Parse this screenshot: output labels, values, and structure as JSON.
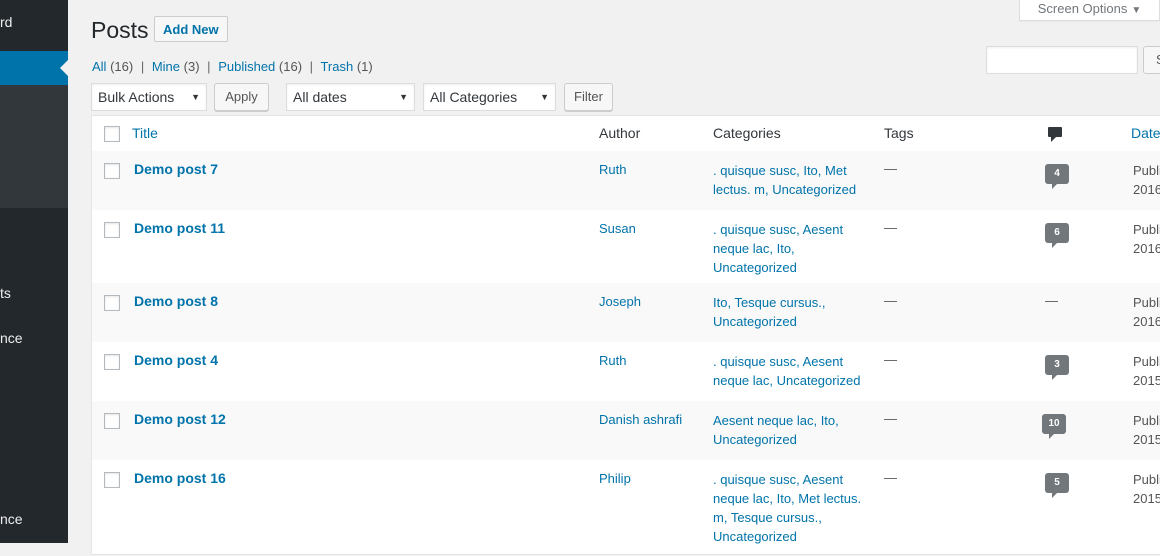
{
  "sidebar": {
    "items": [
      {
        "label": "Dashboard",
        "visible_text": "rd"
      },
      {
        "label": "Posts",
        "visible_text": "ts"
      },
      {
        "label": "Appearance",
        "visible_text": "nce"
      },
      {
        "label": "Appearance",
        "visible_text": "nce"
      }
    ],
    "accent_color": "#0073aa",
    "background_color": "#23282d"
  },
  "screen_options": {
    "label": "Screen Options"
  },
  "header": {
    "title": "Posts",
    "add_new_label": "Add New"
  },
  "filters": {
    "all": {
      "label": "All",
      "count": "(16)"
    },
    "mine": {
      "label": "Mine",
      "count": "(3)"
    },
    "published": {
      "label": "Published",
      "count": "(16)"
    },
    "trash": {
      "label": "Trash",
      "count": "(1)"
    },
    "separator": "|"
  },
  "search": {
    "placeholder": "",
    "button_label": "S"
  },
  "tablenav": {
    "bulk_actions": "Bulk Actions",
    "apply_label": "Apply",
    "dates": "All dates",
    "categories": "All Categories",
    "filter_label": "Filter"
  },
  "table": {
    "columns": {
      "title": "Title",
      "author": "Author",
      "categories": "Categories",
      "tags": "Tags",
      "comments_icon": "comment-icon",
      "date": "Date"
    },
    "rows": [
      {
        "title": "Demo post 7",
        "author": "Ruth",
        "categories": ". quisque susc, Ito, Met lectus. m, Uncategorized",
        "tags": "—",
        "comments": "4",
        "date_status": "Publi",
        "date_year": "2016"
      },
      {
        "title": "Demo post 11",
        "author": "Susan",
        "categories": ". quisque susc, Aesent neque lac, Ito, Uncategorized",
        "tags": "—",
        "comments": "6",
        "date_status": "Publi",
        "date_year": "2016"
      },
      {
        "title": "Demo post 8",
        "author": "Joseph",
        "categories": "Ito, Tesque cursus., Uncategorized",
        "tags": "—",
        "comments": "—",
        "date_status": "Publi",
        "date_year": "2016"
      },
      {
        "title": "Demo post 4",
        "author": "Ruth",
        "categories": ". quisque susc, Aesent neque lac, Uncategorized",
        "tags": "—",
        "comments": "3",
        "date_status": "Publi",
        "date_year": "2015"
      },
      {
        "title": "Demo post 12",
        "author": "Danish ashrafi",
        "categories": "Aesent neque lac, Ito, Uncategorized",
        "tags": "—",
        "comments": "10",
        "date_status": "Publi",
        "date_year": "2015"
      },
      {
        "title": "Demo post 16",
        "author": "Philip",
        "categories": ". quisque susc, Aesent neque lac, Ito, Met lectus. m, Tesque cursus., Uncategorized",
        "tags": "—",
        "comments": "5",
        "date_status": "Publi",
        "date_year": "2015"
      }
    ]
  }
}
